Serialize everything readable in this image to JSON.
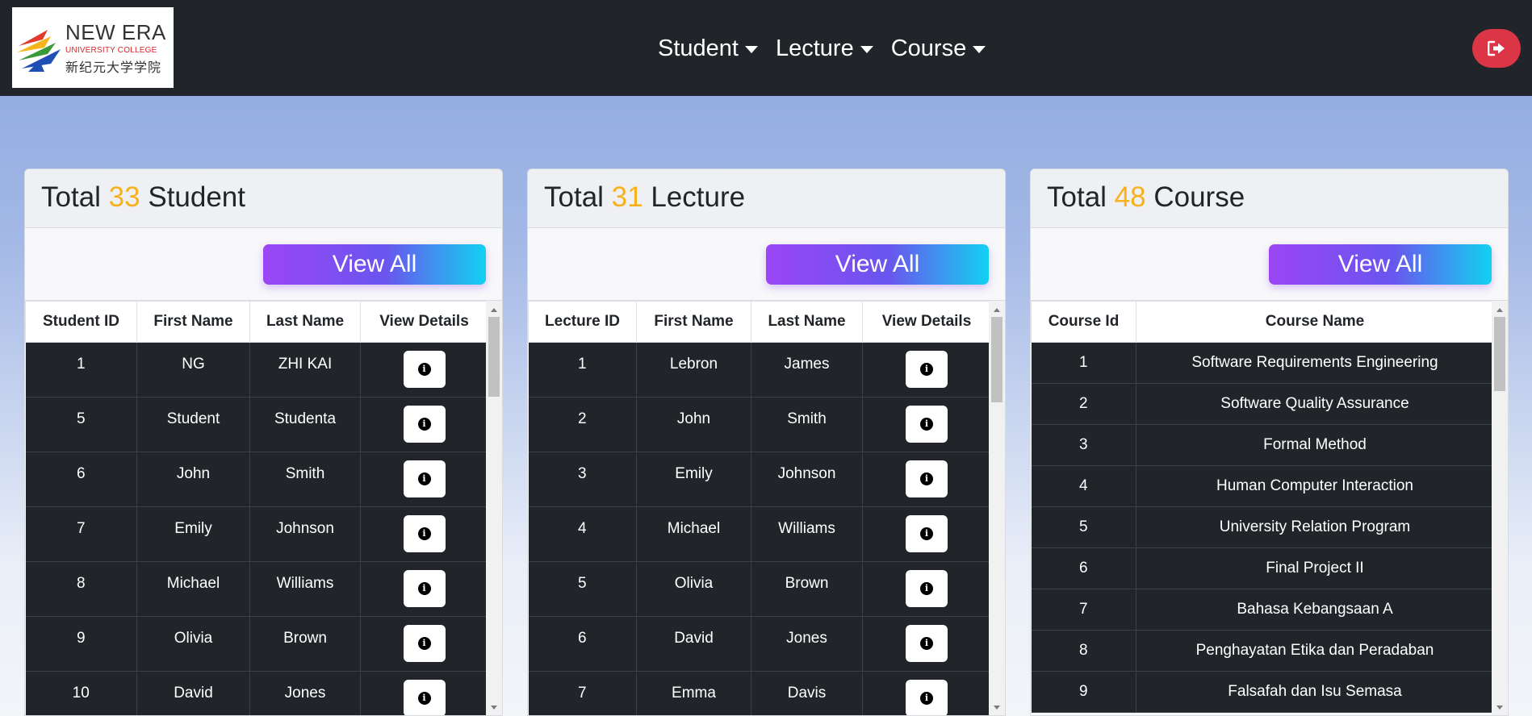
{
  "brand": {
    "name_line1": "NEW ERA",
    "name_line2": "UNIVERSITY COLLEGE",
    "name_chinese": "新纪元大学学院"
  },
  "nav": {
    "items": [
      {
        "label": "Student"
      },
      {
        "label": "Lecture"
      },
      {
        "label": "Course"
      }
    ],
    "logout_icon": "sign-out-icon"
  },
  "colors": {
    "navbar": "#212529",
    "accent_count": "#f7b11c",
    "logout": "#dc3545",
    "button_gradient": [
      "#9b46f5",
      "#12d1f1"
    ]
  },
  "students": {
    "title_prefix": "Total",
    "count": "33",
    "title_suffix": "Student",
    "view_all": "View All",
    "columns": [
      "Student ID",
      "First Name",
      "Last Name",
      "View Details"
    ],
    "rows": [
      {
        "id": "1",
        "first": "NG",
        "last": "ZHI KAI"
      },
      {
        "id": "5",
        "first": "Student",
        "last": "Studenta"
      },
      {
        "id": "6",
        "first": "John",
        "last": "Smith"
      },
      {
        "id": "7",
        "first": "Emily",
        "last": "Johnson"
      },
      {
        "id": "8",
        "first": "Michael",
        "last": "Williams"
      },
      {
        "id": "9",
        "first": "Olivia",
        "last": "Brown"
      },
      {
        "id": "10",
        "first": "David",
        "last": "Jones"
      }
    ]
  },
  "lectures": {
    "title_prefix": "Total",
    "count": "31",
    "title_suffix": "Lecture",
    "view_all": "View All",
    "columns": [
      "Lecture ID",
      "First Name",
      "Last Name",
      "View Details"
    ],
    "rows": [
      {
        "id": "1",
        "first": "Lebron",
        "last": "James"
      },
      {
        "id": "2",
        "first": "John",
        "last": "Smith"
      },
      {
        "id": "3",
        "first": "Emily",
        "last": "Johnson"
      },
      {
        "id": "4",
        "first": "Michael",
        "last": "Williams"
      },
      {
        "id": "5",
        "first": "Olivia",
        "last": "Brown"
      },
      {
        "id": "6",
        "first": "David",
        "last": "Jones"
      },
      {
        "id": "7",
        "first": "Emma",
        "last": "Davis"
      }
    ]
  },
  "courses": {
    "title_prefix": "Total",
    "count": "48",
    "title_suffix": "Course",
    "view_all": "View All",
    "columns": [
      "Course Id",
      "Course Name"
    ],
    "rows": [
      {
        "id": "1",
        "name": "Software Requirements Engineering"
      },
      {
        "id": "2",
        "name": "Software Quality Assurance"
      },
      {
        "id": "3",
        "name": "Formal Method"
      },
      {
        "id": "4",
        "name": "Human Computer Interaction"
      },
      {
        "id": "5",
        "name": "University Relation Program"
      },
      {
        "id": "6",
        "name": "Final Project II"
      },
      {
        "id": "7",
        "name": "Bahasa Kebangsaan A"
      },
      {
        "id": "8",
        "name": "Penghayatan Etika dan Peradaban"
      },
      {
        "id": "9",
        "name": "Falsafah dan Isu Semasa"
      }
    ]
  }
}
